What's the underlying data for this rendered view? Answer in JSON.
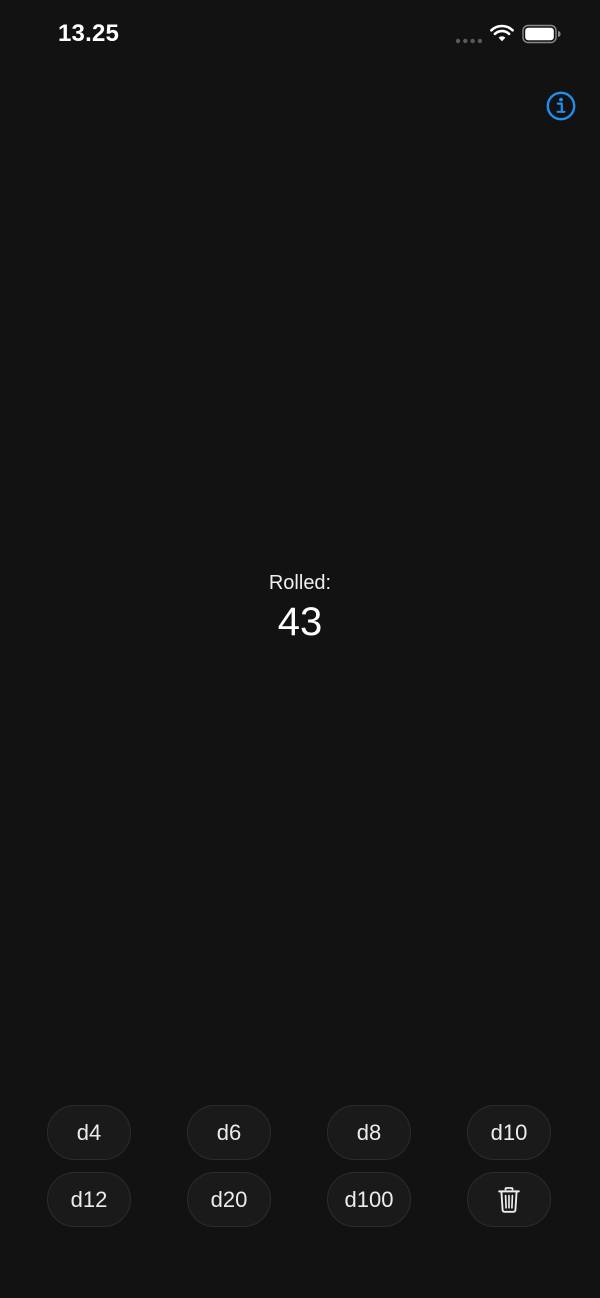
{
  "status_bar": {
    "time": "13.25",
    "icons": [
      "signal-dots-icon",
      "wifi-icon",
      "battery-icon"
    ]
  },
  "toolbar": {
    "info_icon": "info-circle-icon"
  },
  "roll": {
    "label": "Rolled:",
    "value": "43"
  },
  "dice": {
    "buttons": [
      "d4",
      "d6",
      "d8",
      "d10",
      "d12",
      "d20",
      "d100"
    ],
    "clear_icon": "trash-icon"
  },
  "colors": {
    "background": "#121212",
    "accent": "#1f8ff0",
    "button_bg": "#1a1a1a",
    "button_border": "#2c2c2c",
    "text": "#ffffff"
  }
}
